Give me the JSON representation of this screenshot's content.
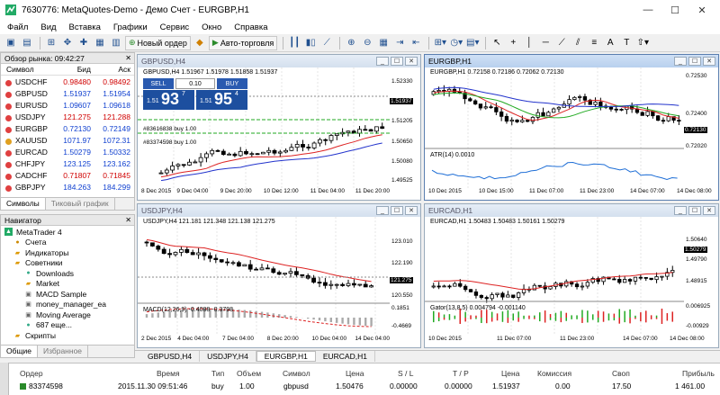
{
  "window": {
    "title": "7630776: MetaQuotes-Demo - Демо Счет - EURGBP,H1"
  },
  "menu": [
    "Файл",
    "Вид",
    "Вставка",
    "Графики",
    "Сервис",
    "Окно",
    "Справка"
  ],
  "toolbar": {
    "new_order": "Новый ордер",
    "autotrading": "Авто-торговля"
  },
  "market_watch": {
    "title": "Обзор рынка: 09:42:27",
    "headers": [
      "Символ",
      "Бид",
      "Аск"
    ],
    "rows": [
      {
        "symbol": "USDCHF",
        "bid": "0.98480",
        "ask": "0.98492",
        "bid_color": "#d00000",
        "dot": "#e04040"
      },
      {
        "symbol": "GBPUSD",
        "bid": "1.51937",
        "ask": "1.51954",
        "bid_color": "#1040d0",
        "dot": "#e04040"
      },
      {
        "symbol": "EURUSD",
        "bid": "1.09607",
        "ask": "1.09618",
        "bid_color": "#1040d0",
        "dot": "#e04040"
      },
      {
        "symbol": "USDJPY",
        "bid": "121.275",
        "ask": "121.288",
        "bid_color": "#d00000",
        "dot": "#e04040"
      },
      {
        "symbol": "EURGBP",
        "bid": "0.72130",
        "ask": "0.72149",
        "bid_color": "#1040d0",
        "dot": "#e04040"
      },
      {
        "symbol": "XAUUSD",
        "bid": "1071.97",
        "ask": "1072.31",
        "bid_color": "#1040d0",
        "dot": "#e0a020"
      },
      {
        "symbol": "EURCAD",
        "bid": "1.50279",
        "ask": "1.50332",
        "bid_color": "#1040d0",
        "dot": "#e04040"
      },
      {
        "symbol": "CHFJPY",
        "bid": "123.125",
        "ask": "123.162",
        "bid_color": "#1040d0",
        "dot": "#e04040"
      },
      {
        "symbol": "CADCHF",
        "bid": "0.71807",
        "ask": "0.71845",
        "bid_color": "#d00000",
        "dot": "#e04040"
      },
      {
        "symbol": "GBPJPY",
        "bid": "184.263",
        "ask": "184.299",
        "bid_color": "#1040d0",
        "dot": "#e04040"
      }
    ],
    "tabs": [
      "Символы",
      "Тиковый график"
    ]
  },
  "navigator": {
    "title": "Навигатор",
    "items": [
      "MetaTrader 4",
      "Счета",
      "Индикаторы",
      "Советники",
      "Downloads",
      "Market",
      "MACD Sample",
      "money_manager_ea",
      "Moving Average",
      "687 еще...",
      "Скрипты"
    ],
    "tabs": [
      "Общие",
      "Избранное"
    ]
  },
  "charts": {
    "gbpusd": {
      "title": "GBPUSD,H4",
      "info": "GBPUSD,H4  1.51967 1.51978 1.51858 1.51937",
      "sell": "SELL",
      "buy": "BUY",
      "lot": "0.10",
      "sell_big": "93",
      "sell_small": "1.51",
      "sell_sup": "7",
      "buy_big": "95",
      "buy_small": "1.51",
      "buy_sup": "4",
      "order1": "#83616838 buy 1.00",
      "order2": "#83374598 buy 1.00",
      "y_ticks": [
        "1.52330",
        "1.51937",
        "1.51205",
        "1.50650",
        "1.50080",
        "1.49525"
      ],
      "price": "1.51937",
      "x_ticks": [
        "8 Dec 2015",
        "9 Dec 04:00",
        "9 Dec 20:00",
        "10 Dec 12:00",
        "11 Dec 04:00",
        "11 Dec 20:00"
      ]
    },
    "eurgbp": {
      "title": "EURGBP,H1",
      "info": "EURGBP,H1  0.72158 0.72186 0.72062 0.72130",
      "y_ticks": [
        "0.72530",
        "0.72400",
        "0.72130",
        "0.72020"
      ],
      "price": "0.72130",
      "atr": "ATR(14) 0.0010",
      "x_ticks": [
        "10 Dec 2015",
        "10 Dec 15:00",
        "11 Dec 07:00",
        "11 Dec 23:00",
        "14 Dec 07:00",
        "14 Dec 08:00"
      ]
    },
    "usdjpy": {
      "title": "USDJPY,H4",
      "info": "USDJPY,H4  121.181 121.348 121.138 121.275",
      "y_ticks": [
        "123.010",
        "122.190",
        "121.275",
        "120.550"
      ],
      "price": "121.275",
      "macd": "MACD(12,26,9) -0.4088 -0.3798",
      "macd_ticks": [
        "0.1851",
        "-0.4669"
      ],
      "x_ticks": [
        "2 Dec 2015",
        "4 Dec 04:00",
        "7 Dec 04:00",
        "8 Dec 20:00",
        "10 Dec 04:00",
        "14 Dec 04:00"
      ]
    },
    "eurcad": {
      "title": "EURCAD,H1",
      "info": "EURCAD,H1  1.50483 1.50483 1.50161 1.50279",
      "y_ticks": [
        "1.50640",
        "1.50279",
        "1.49790",
        "1.48915"
      ],
      "price": "1.50279",
      "gator": "Gator(13,8,5) 0.004794 -0.001140",
      "gator_ticks": [
        "0.006925",
        "-0.00929"
      ],
      "x_ticks": [
        "10 Dec 2015",
        "11 Dec 07:00",
        "11 Dec 23:00",
        "14 Dec 07:00",
        "14 Dec 08:00"
      ]
    }
  },
  "chart_tabs": [
    "GBPUSD,H4",
    "USDJPY,H4",
    "EURGBP,H1",
    "EURCAD,H1"
  ],
  "terminal": {
    "headers": [
      "Ордер",
      "Время",
      "Тип",
      "Объем",
      "Символ",
      "Цена",
      "S / L",
      "T / P",
      "Цена",
      "Комиссия",
      "Своп",
      "Прибыль"
    ],
    "row": [
      "83374598",
      "2015.11.30 09:51:46",
      "buy",
      "1.00",
      "gbpusd",
      "1.50476",
      "0.00000",
      "0.00000",
      "1.51937",
      "0.00",
      "17.50",
      "1 461.00"
    ]
  }
}
